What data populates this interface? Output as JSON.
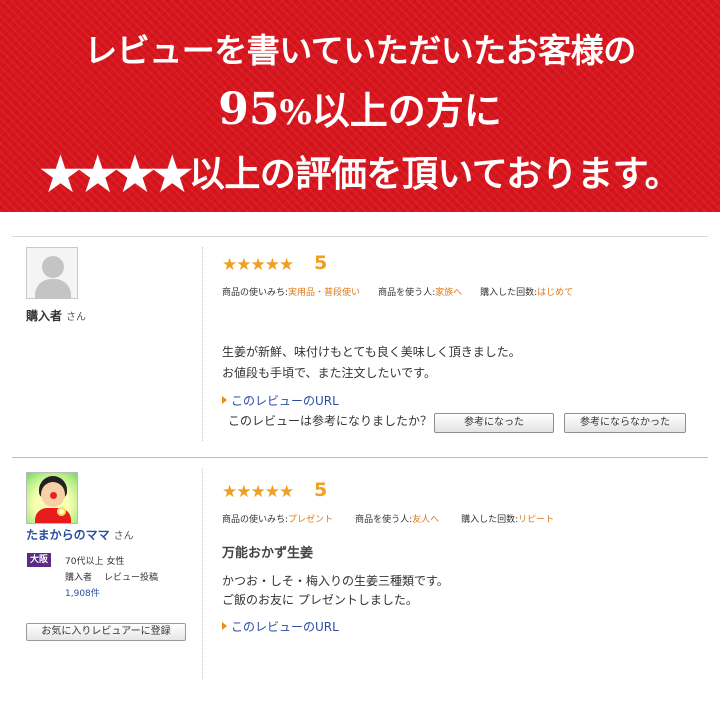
{
  "banner": {
    "line1": "レビューを書いていただいたお客様の",
    "line2_pct": "95",
    "line2_pct_sign": "%",
    "line2_rest": "以上の方に",
    "line3_stars": "★★★★",
    "line3_rest": "以上の評価を頂いております。",
    "bg_color": "#d8141c"
  },
  "reviews": [
    {
      "reviewer": {
        "name": "購入者",
        "honorific": "さん",
        "avatar": "default-user-avatar"
      },
      "stars": "★★★★★",
      "score": "5",
      "meta": {
        "usage_label": "商品の使いみち:",
        "usage_value": "実用品・普段使い",
        "user_label": "商品を使う人:",
        "user_value": "家族へ",
        "times_label": "購入した回数:",
        "times_value": "はじめて"
      },
      "body": [
        "生姜が新鮮、味付けもとても良く美味しく頂きました。",
        "お値段も手頃で、また注文したいです。"
      ],
      "url_link": "このレビューのURL",
      "helpful": {
        "question": "このレビューは参考になりましたか？",
        "yes": "参考になった",
        "no": "参考にならなかった"
      }
    },
    {
      "reviewer": {
        "name": "たまからのママ",
        "honorific": "さん",
        "avatar": "user-photo-avatar",
        "rank_badge": "大阪",
        "age_gender": "70代以上 女性",
        "role": "購入者",
        "post_type": "レビュー投稿",
        "count": "1,908件",
        "fav_button": "お気に入りレビュアーに登録"
      },
      "stars": "★★★★★",
      "score": "5",
      "meta": {
        "usage_label": "商品の使いみち:",
        "usage_value": "プレゼント",
        "user_label": "商品を使う人:",
        "user_value": "友人へ",
        "times_label": "購入した回数:",
        "times_value": "リピート"
      },
      "title": "万能おかず生姜",
      "body": [
        "かつお・しそ・梅入りの生姜三種類です。",
        "ご飯のお友に プレゼントしました。"
      ],
      "url_link": "このレビューのURL"
    }
  ],
  "colors": {
    "star": "#f0a020",
    "meta_value": "#e07818",
    "link": "#2a4ea0"
  }
}
